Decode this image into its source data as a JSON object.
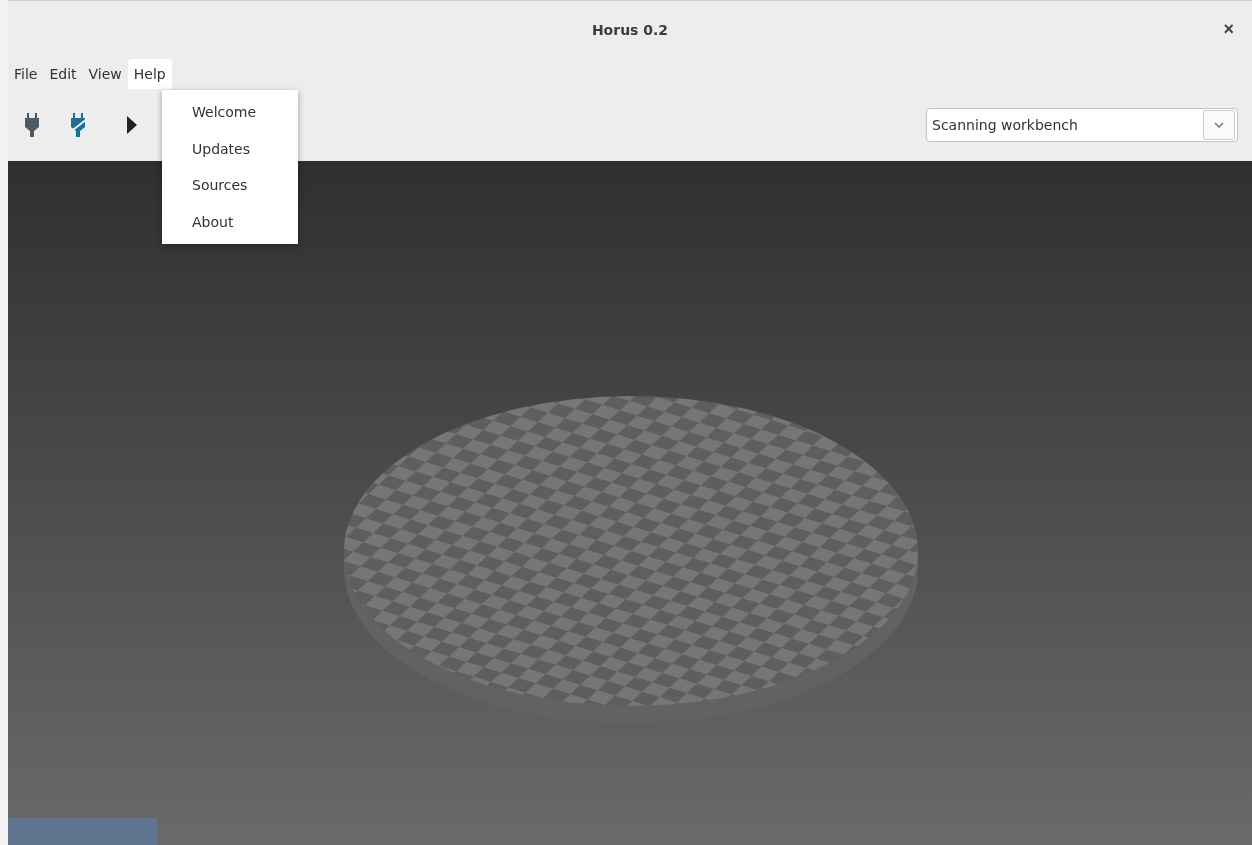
{
  "window": {
    "title": "Horus 0.2",
    "close": "×"
  },
  "menu_bar": [
    {
      "label": "File",
      "selected": false
    },
    {
      "label": "Edit",
      "selected": false
    },
    {
      "label": "View",
      "selected": false
    },
    {
      "label": "Help",
      "selected": true
    }
  ],
  "open_menu": {
    "items": [
      {
        "label": "Welcome"
      },
      {
        "label": "Updates"
      },
      {
        "label": "Sources"
      },
      {
        "label": "About"
      }
    ]
  },
  "toolbar": {
    "buttons": [
      {
        "kind": "connect"
      },
      {
        "kind": "disconnect"
      },
      {
        "kind": "play"
      }
    ],
    "workbench": {
      "value": "Scanning workbench"
    }
  }
}
